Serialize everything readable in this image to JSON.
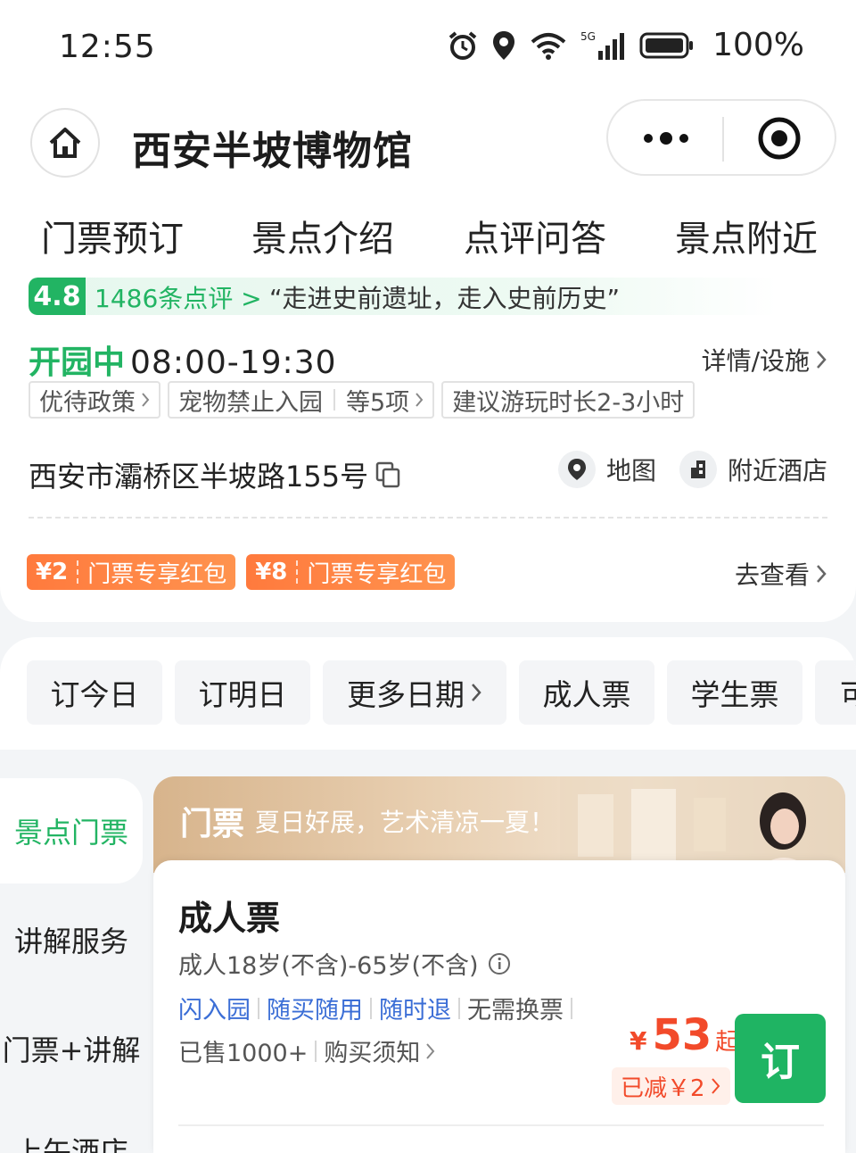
{
  "status_bar": {
    "time": "12:55",
    "battery_pct": "100%",
    "network": "5G",
    "icons": [
      "alarm-icon",
      "location-icon",
      "wifi-icon",
      "signal-icon",
      "battery-icon"
    ]
  },
  "header": {
    "title": "西安半坡博物馆",
    "home_icon": "home-icon",
    "more_icon": "more-dots-icon",
    "close_icon": "target-close-icon"
  },
  "tabs": [
    {
      "label": "门票预订"
    },
    {
      "label": "景点介绍"
    },
    {
      "label": "点评问答"
    },
    {
      "label": "景点附近"
    }
  ],
  "overview": {
    "score": "4.8",
    "review_count": "1486条点评 >",
    "quote": "“走进史前遗址，走入史前历史”",
    "status": "开园中",
    "hours": "08:00-19:30",
    "detail_link": "详情/设施",
    "chips": [
      "优待政策",
      "宠物禁止入园",
      "等5项",
      "建议游玩时长2-3小时"
    ],
    "address": "西安市灞桥区半坡路155号",
    "map_label": "地图",
    "hotel_label": "附近酒店",
    "coupons": [
      {
        "amount": "¥2",
        "label": "门票专享红包"
      },
      {
        "amount": "¥8",
        "label": "门票专享红包"
      }
    ],
    "go_view": "去查看"
  },
  "filters": [
    "订今日",
    "订明日",
    "更多日期",
    "成人票",
    "学生票",
    "可"
  ],
  "side_menu": [
    "景点门票",
    "讲解服务",
    "门票+讲解",
    "上午酒店"
  ],
  "banner": {
    "title": "门票",
    "subtitle": "夏日好展，艺术清凉一夏！"
  },
  "product": {
    "name": "成人票",
    "age_rule": "成人18岁(不含)-65岁(不含)",
    "tags": [
      "闪入园",
      "随买随用",
      "随时退",
      "无需换票"
    ],
    "sold": "已售1000+",
    "notice": "购买须知",
    "currency": "¥",
    "price": "53",
    "price_suffix": "起",
    "discount": "已减￥2",
    "book_label": "订"
  },
  "colors": {
    "accent_green": "#22b463",
    "price_red": "#f24a2a",
    "tag_blue": "#3b6ed6",
    "coupon_orange": "#ff7a3d"
  }
}
